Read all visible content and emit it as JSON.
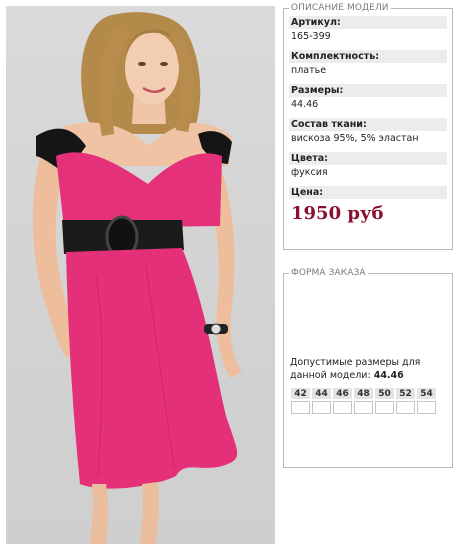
{
  "description": {
    "legend": "ОПИСАНИЕ МОДЕЛИ",
    "rows": [
      {
        "label": "Артикул:",
        "value": "165-399"
      },
      {
        "label": "Комплектность:",
        "value": "платье"
      },
      {
        "label": "Размеры:",
        "value": "44.46"
      },
      {
        "label": "Состав ткани:",
        "value": "вискоза 95%, 5% эластан"
      },
      {
        "label": "Цвета:",
        "value": "фуксия"
      }
    ],
    "price_label": "Цена:",
    "price": "1950 руб"
  },
  "order": {
    "legend": "ФОРМА ЗАКАЗА",
    "note_text": "Допустимые размеры для данной модели:",
    "note_sizes": "44.46",
    "sizes": [
      "42",
      "44",
      "46",
      "48",
      "50",
      "52",
      "54"
    ]
  },
  "colors": {
    "dress": "#e5307a",
    "price": "#8a1030",
    "label_bg": "#ececec"
  }
}
